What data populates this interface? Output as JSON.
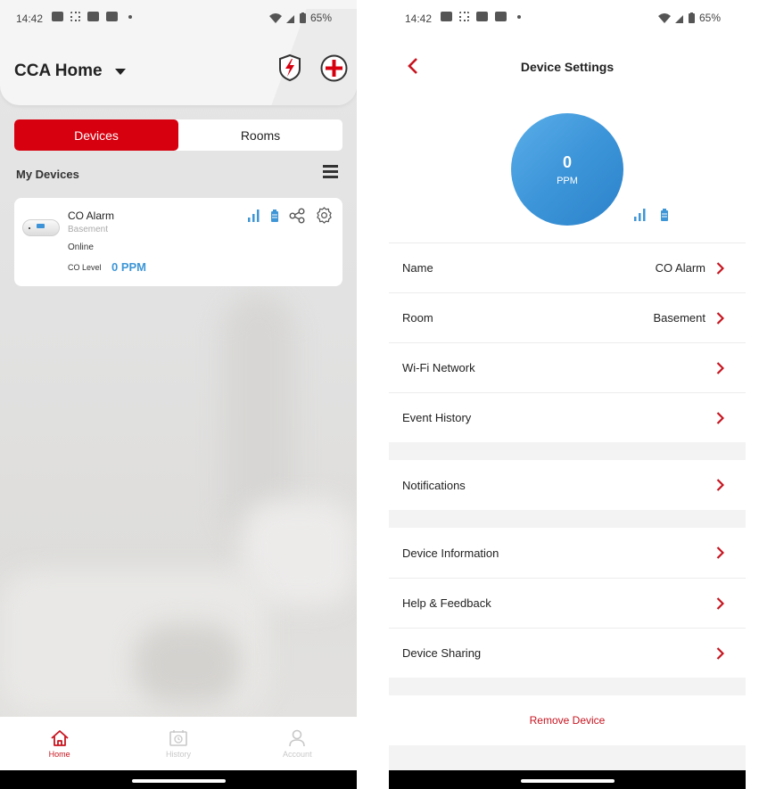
{
  "status_bar": {
    "time": "14:42",
    "battery": "65%",
    "notification_icons": [
      "news-icon",
      "slack-icon",
      "youtube-icon",
      "youtube-icon",
      "dot-icon"
    ],
    "system_icons": [
      "wifi-icon",
      "cell-signal-icon",
      "battery-icon"
    ]
  },
  "home": {
    "title": "CCA Home",
    "tabs": [
      {
        "label": "Devices",
        "active": true
      },
      {
        "label": "Rooms",
        "active": false
      }
    ],
    "section_title": "My Devices",
    "device": {
      "name": "CO Alarm",
      "room": "Basement",
      "status": "Online",
      "co_label": "CO Level",
      "co_value": "0 PPM"
    },
    "bottom_nav": [
      {
        "label": "Home",
        "icon": "home-icon",
        "active": true
      },
      {
        "label": "History",
        "icon": "history-icon",
        "active": false
      },
      {
        "label": "Account",
        "icon": "account-icon",
        "active": false
      }
    ]
  },
  "device_settings": {
    "title": "Device Settings",
    "ppm_value": "0",
    "ppm_unit": "PPM",
    "groups": [
      [
        {
          "label": "Name",
          "value": "CO Alarm"
        },
        {
          "label": "Room",
          "value": "Basement"
        },
        {
          "label": "Wi-Fi Network",
          "value": ""
        },
        {
          "label": "Event History",
          "value": ""
        }
      ],
      [
        {
          "label": "Notifications",
          "value": ""
        }
      ],
      [
        {
          "label": "Device Information",
          "value": ""
        },
        {
          "label": "Help & Feedback",
          "value": ""
        },
        {
          "label": "Device Sharing",
          "value": ""
        }
      ]
    ],
    "remove_label": "Remove Device"
  },
  "colors": {
    "brand_red": "#d6000f",
    "accent_blue": "#3e96d6",
    "chevron_red": "#c7141f"
  }
}
